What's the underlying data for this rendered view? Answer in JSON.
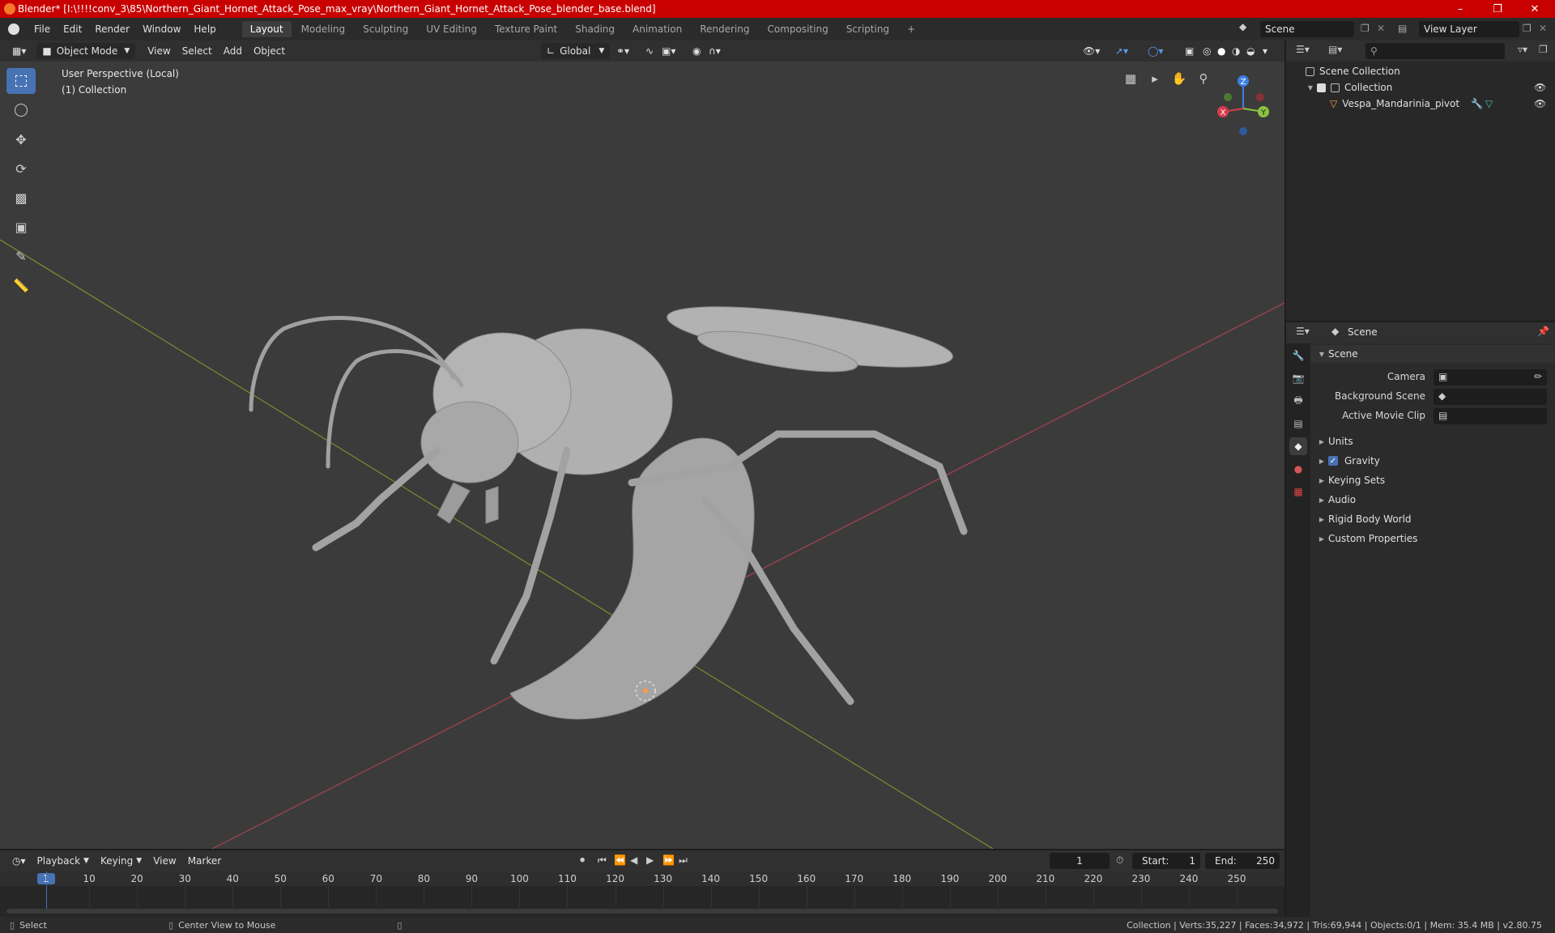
{
  "window": {
    "title": "Blender* [I:\\!!!!conv_3\\85\\Northern_Giant_Hornet_Attack_Pose_max_vray\\Northern_Giant_Hornet_Attack_Pose_blender_base.blend]",
    "minimize": "–",
    "maximize": "❐",
    "close": "✕"
  },
  "menubar": {
    "items": [
      "File",
      "Edit",
      "Render",
      "Window",
      "Help"
    ],
    "workspaces": [
      "Layout",
      "Modeling",
      "Sculpting",
      "UV Editing",
      "Texture Paint",
      "Shading",
      "Animation",
      "Rendering",
      "Compositing",
      "Scripting"
    ],
    "add_workspace": "+",
    "scene_name": "Scene",
    "view_layer": "View Layer"
  },
  "viewport_header": {
    "mode": "Object Mode",
    "menus": [
      "View",
      "Select",
      "Add",
      "Object"
    ],
    "orientation": "Global"
  },
  "viewport": {
    "perspective_label": "User Perspective (Local)",
    "collection_label": "(1) Collection",
    "gizmo": {
      "x": "X",
      "y": "Y",
      "z": "Z"
    }
  },
  "timeline": {
    "menus": [
      "Playback",
      "Keying",
      "View",
      "Marker"
    ],
    "current_frame": "1",
    "start_label": "Start:",
    "start": "1",
    "end_label": "End:",
    "end": "250",
    "ticks": [
      "1",
      "10",
      "20",
      "30",
      "40",
      "50",
      "60",
      "70",
      "80",
      "90",
      "100",
      "110",
      "120",
      "130",
      "140",
      "150",
      "160",
      "170",
      "180",
      "190",
      "200",
      "210",
      "220",
      "230",
      "240",
      "250"
    ]
  },
  "statusbar": {
    "select": "Select",
    "center": "Center View to Mouse",
    "stats": "Collection | Verts:35,227 | Faces:34,972 | Tris:69,944 | Objects:0/1 | Mem: 35.4 MB | v2.80.75"
  },
  "outliner": {
    "scene_collection": "Scene Collection",
    "collection": "Collection",
    "object": "Vespa_Mandarinia_pivot"
  },
  "properties": {
    "header_title": "Scene",
    "panel_scene": "Scene",
    "camera_label": "Camera",
    "background_label": "Background Scene",
    "movie_clip_label": "Active Movie Clip",
    "sections": [
      "Units",
      "Gravity",
      "Keying Sets",
      "Audio",
      "Rigid Body World",
      "Custom Properties"
    ]
  },
  "colors": {
    "accent": "#4772b3",
    "titlebar": "#c80000",
    "x_axis": "#d83c4e",
    "y_axis": "#8bc53f",
    "z_axis": "#3d7fe0"
  }
}
